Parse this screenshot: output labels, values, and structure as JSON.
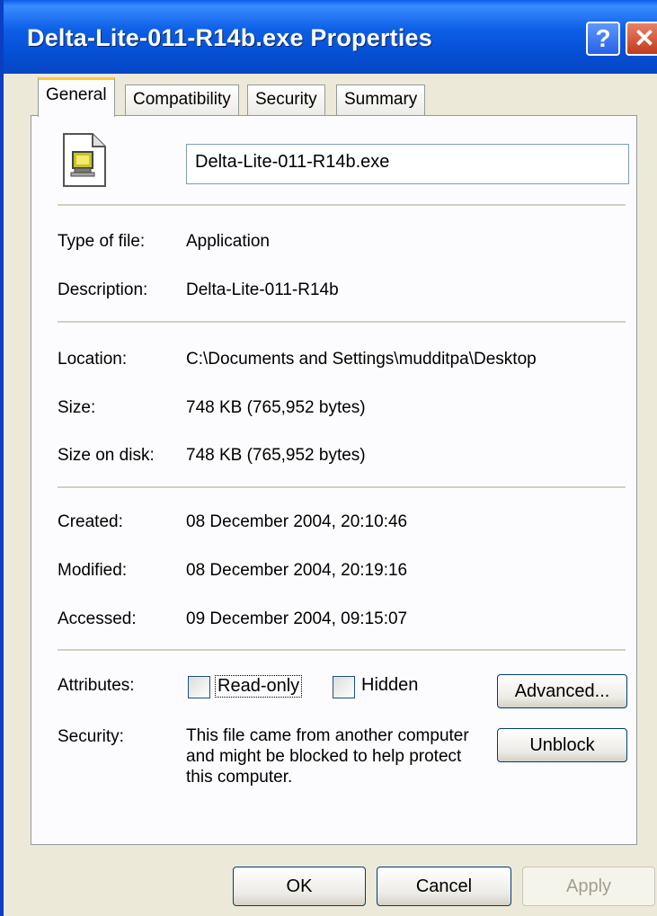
{
  "window": {
    "title": "Delta-Lite-011-R14b.exe Properties",
    "help_label": "?",
    "close_label": "✕"
  },
  "tabs": [
    {
      "label": "General",
      "active": true
    },
    {
      "label": "Compatibility",
      "active": false
    },
    {
      "label": "Security",
      "active": false
    },
    {
      "label": "Summary",
      "active": false
    }
  ],
  "general": {
    "filename": "Delta-Lite-011-R14b.exe",
    "type_label": "Type of file:",
    "type_value": "Application",
    "description_label": "Description:",
    "description_value": "Delta-Lite-011-R14b",
    "location_label": "Location:",
    "location_value": "C:\\Documents and Settings\\mudditpa\\Desktop",
    "size_label": "Size:",
    "size_value": "748 KB (765,952 bytes)",
    "size_on_disk_label": "Size on disk:",
    "size_on_disk_value": "748 KB (765,952 bytes)",
    "created_label": "Created:",
    "created_value": "08 December 2004, 20:10:46",
    "modified_label": "Modified:",
    "modified_value": "08 December 2004, 20:19:16",
    "accessed_label": "Accessed:",
    "accessed_value": "09 December 2004, 09:15:07",
    "attributes_label": "Attributes:",
    "readonly_label": "Read-only",
    "readonly_checked": false,
    "hidden_label": "Hidden",
    "hidden_checked": false,
    "advanced_label": "Advanced...",
    "security_label": "Security:",
    "security_text": "This file came from another computer and might be blocked to help protect this computer.",
    "unblock_label": "Unblock"
  },
  "footer": {
    "ok_label": "OK",
    "cancel_label": "Cancel",
    "apply_label": "Apply"
  },
  "colors": {
    "titlebar": "#0550d6",
    "dialog_bg": "#ece9d8",
    "active_tab_accent": "#ffc83c",
    "button_border": "#003c74"
  }
}
